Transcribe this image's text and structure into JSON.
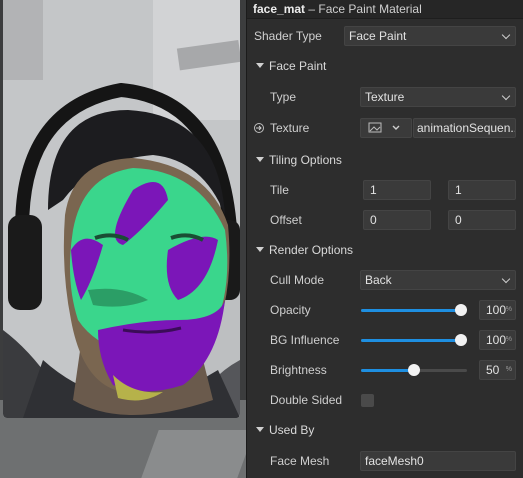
{
  "header": {
    "asset_name": "face_mat",
    "separator": " – ",
    "asset_type": "Face Paint Material"
  },
  "shader_type": {
    "label": "Shader Type",
    "value": "Face Paint"
  },
  "sections": {
    "face_paint": "Face Paint",
    "tiling_options": "Tiling Options",
    "render_options": "Render Options",
    "used_by": "Used By"
  },
  "face_paint": {
    "type_label": "Type",
    "type_value": "Texture",
    "texture_label": "Texture",
    "texture_value": "animationSequen..."
  },
  "tiling": {
    "tile_label": "Tile",
    "tile_x": "1",
    "tile_y": "1",
    "offset_label": "Offset",
    "offset_x": "0",
    "offset_y": "0"
  },
  "render": {
    "cull_mode_label": "Cull Mode",
    "cull_mode_value": "Back",
    "opacity_label": "Opacity",
    "opacity_value": "100",
    "opacity": 1.0,
    "bg_influence_label": "BG Influence",
    "bg_influence_value": "100",
    "bg_influence": 1.0,
    "brightness_label": "Brightness",
    "brightness_value": "50",
    "brightness": 0.5,
    "unit": "%",
    "double_sided_label": "Double Sided",
    "double_sided": false
  },
  "used_by": {
    "face_mesh_label": "Face Mesh",
    "face_mesh_value": "faceMesh0"
  },
  "colors": {
    "accent": "#1e8fe1",
    "paint_green": "#3ad68c",
    "paint_purple": "#7b16b8"
  }
}
